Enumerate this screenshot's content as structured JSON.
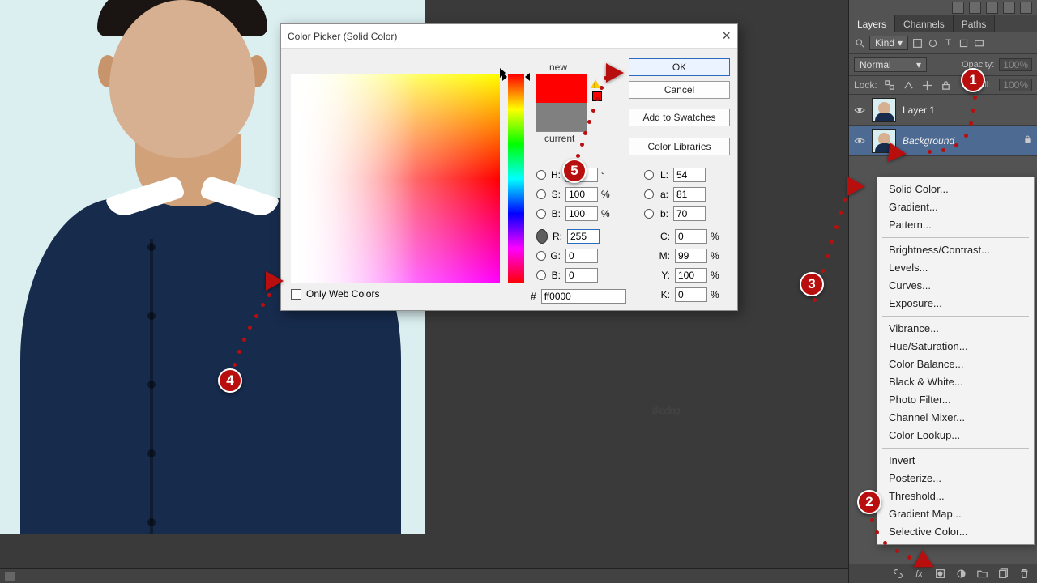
{
  "dialog": {
    "title": "Color Picker (Solid Color)",
    "new_label": "new",
    "current_label": "current",
    "ok": "OK",
    "cancel": "Cancel",
    "add_swatch": "Add to Swatches",
    "color_libraries": "Color Libraries",
    "only_web": "Only Web Colors",
    "deg": "°",
    "pct": "%",
    "hash": "#",
    "fields": {
      "H": {
        "label": "H:",
        "value": ""
      },
      "S": {
        "label": "S:",
        "value": "100"
      },
      "Bhsb": {
        "label": "B:",
        "value": "100"
      },
      "R": {
        "label": "R:",
        "value": "255"
      },
      "G": {
        "label": "G:",
        "value": "0"
      },
      "Brgb": {
        "label": "B:",
        "value": "0"
      },
      "L": {
        "label": "L:",
        "value": "54"
      },
      "a": {
        "label": "a:",
        "value": "81"
      },
      "b": {
        "label": "b:",
        "value": "70"
      },
      "C": {
        "label": "C:",
        "value": "0"
      },
      "M": {
        "label": "M:",
        "value": "99"
      },
      "Y": {
        "label": "Y:",
        "value": "100"
      },
      "K": {
        "label": "K:",
        "value": "0"
      },
      "hex": {
        "value": "ff0000"
      }
    }
  },
  "panels": {
    "tabs": {
      "layers": "Layers",
      "channels": "Channels",
      "paths": "Paths"
    },
    "filter": "Kind",
    "blend": "Normal",
    "opacity_label": "Opacity:",
    "opacity_value": "100%",
    "lock_label": "Lock:",
    "fill_label": "Fill:",
    "fill_value": "100%",
    "layers": [
      {
        "name": "Layer 1",
        "locked": false
      },
      {
        "name": "Background",
        "locked": true
      }
    ]
  },
  "context_menu": {
    "items": [
      "Solid Color...",
      "Gradient...",
      "Pattern...",
      "__sep",
      "Brightness/Contrast...",
      "Levels...",
      "Curves...",
      "Exposure...",
      "__sep",
      "Vibrance...",
      "Hue/Saturation...",
      "Color Balance...",
      "Black & White...",
      "Photo Filter...",
      "Channel Mixer...",
      "Color Lookup...",
      "__sep",
      "Invert",
      "Posterize...",
      "Threshold...",
      "Gradient Map...",
      "Selective Color..."
    ]
  },
  "badges": [
    "1",
    "2",
    "3",
    "4",
    "5"
  ]
}
